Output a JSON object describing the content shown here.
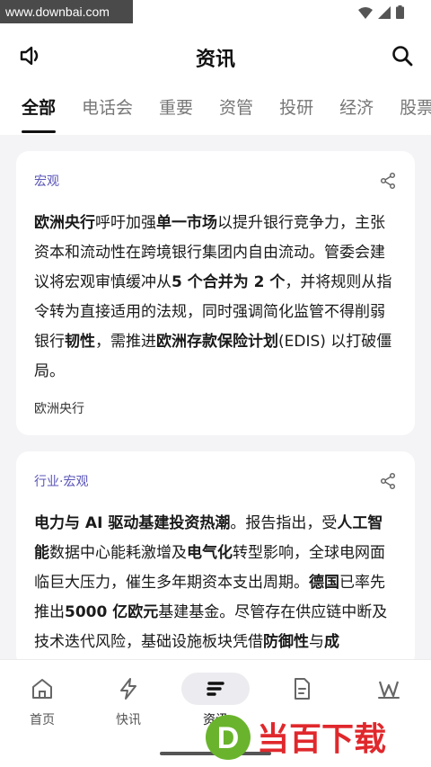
{
  "watermark_top": "www.downbai.com",
  "header": {
    "title": "资讯"
  },
  "tabs": [
    {
      "label": "全部"
    },
    {
      "label": "电话会"
    },
    {
      "label": "重要"
    },
    {
      "label": "资管"
    },
    {
      "label": "投研"
    },
    {
      "label": "经济"
    },
    {
      "label": "股票"
    }
  ],
  "cards": [
    {
      "tag": "宏观",
      "segments": [
        {
          "t": "欧洲央行",
          "b": true
        },
        {
          "t": "呼吁加强",
          "b": false
        },
        {
          "t": "单一市场",
          "b": true
        },
        {
          "t": "以提升银行竞争力，主张资本和流动性在跨境银行集团内自由流动。管委会建议将宏观审慎缓冲从",
          "b": false
        },
        {
          "t": "5 个合并为 2 个",
          "b": true
        },
        {
          "t": "，并将规则从指令转为直接适用的法规，同时强调简化监管不得削弱银行",
          "b": false
        },
        {
          "t": "韧性",
          "b": true
        },
        {
          "t": "，需推进",
          "b": false
        },
        {
          "t": "欧洲存款保险计划",
          "b": true
        },
        {
          "t": "(EDIS) 以打破僵局。",
          "b": false
        }
      ],
      "source": "欧洲央行"
    },
    {
      "tag": "行业·宏观",
      "segments": [
        {
          "t": "电力与 AI 驱动基建投资热潮",
          "b": true
        },
        {
          "t": "。报告指出，受",
          "b": false
        },
        {
          "t": "人工智能",
          "b": true
        },
        {
          "t": "数据中心能耗激增及",
          "b": false
        },
        {
          "t": "电气化",
          "b": true
        },
        {
          "t": "转型影响，全球电网面临巨大压力，催生多年期资本支出周期。",
          "b": false
        },
        {
          "t": "德国",
          "b": true
        },
        {
          "t": "已率先推出",
          "b": false
        },
        {
          "t": "5000 亿欧元",
          "b": true
        },
        {
          "t": "基建基金。尽管存在供应链中断及技术迭代风险，基础设施板块凭借",
          "b": false
        },
        {
          "t": "防御性",
          "b": true
        },
        {
          "t": "与",
          "b": false
        },
        {
          "t": "成",
          "b": true
        }
      ]
    }
  ],
  "bottom_nav": [
    {
      "label": "首页",
      "icon": "home-icon"
    },
    {
      "label": "快讯",
      "icon": "lightning-icon"
    },
    {
      "label": "资讯",
      "icon": "news-icon"
    },
    {
      "label": "",
      "icon": "document-icon"
    },
    {
      "label": "",
      "icon": "wave-logo-icon"
    }
  ],
  "logo_watermark": "当百下载",
  "colors": {
    "accent": "#5a55b8",
    "logo_green": "#6ab42d",
    "logo_red": "#e0282c"
  }
}
